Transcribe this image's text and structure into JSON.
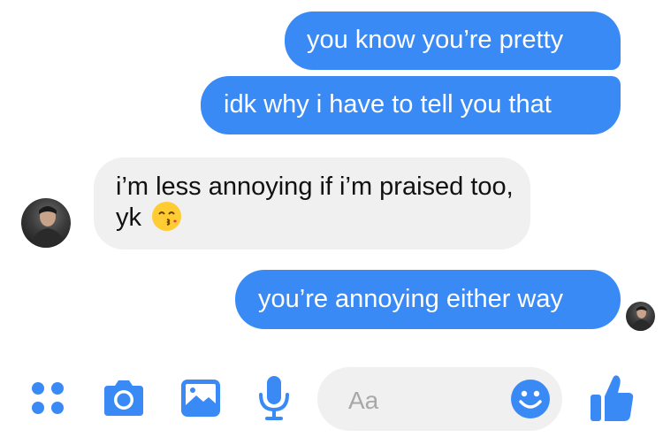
{
  "messages": [
    {
      "sender": "me",
      "text": "you know you’re pretty"
    },
    {
      "sender": "me",
      "text": "idk why i have to tell you that"
    },
    {
      "sender": "them",
      "text": "i’m less annoying if i’m praised too, yk",
      "emoji": "kissing-face-smiling-eyes"
    },
    {
      "sender": "me",
      "text": "you’re annoying either way",
      "seen_indicator": true
    }
  ],
  "composer": {
    "placeholder": "Aa"
  },
  "toolbar": {
    "icons": [
      "more-apps-icon",
      "camera-icon",
      "gallery-icon",
      "microphone-icon",
      "emoji-icon",
      "like-thumb-icon"
    ]
  },
  "colors": {
    "accent": "#3a8af6",
    "incoming_bubble": "#f0f0f0",
    "composer_bg": "#f0f0f0"
  }
}
